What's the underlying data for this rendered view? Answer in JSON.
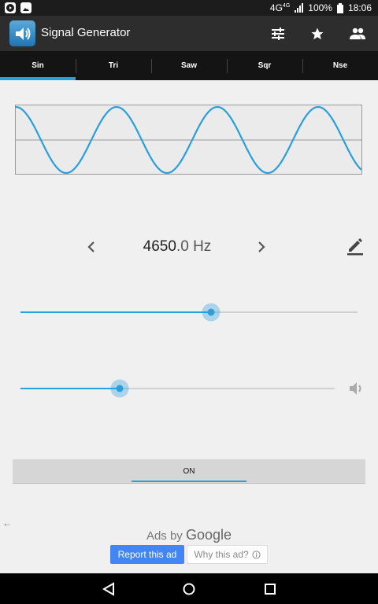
{
  "status_bar": {
    "network": "4G",
    "network_sup": "4G",
    "battery": "100%",
    "time": "18:06"
  },
  "app_bar": {
    "title": "Signal Generator",
    "icons": [
      "app-speaker-icon",
      "tune-icon",
      "star-icon",
      "people-icon"
    ]
  },
  "tabs": [
    {
      "label": "Sin",
      "active": true
    },
    {
      "label": "Tri",
      "active": false
    },
    {
      "label": "Saw",
      "active": false
    },
    {
      "label": "Sqr",
      "active": false
    },
    {
      "label": "Nse",
      "active": false
    }
  ],
  "frequency": {
    "integer": "4650",
    "fraction": ".0 Hz"
  },
  "sliders": {
    "frequency_level": 0.566,
    "volume_level": 0.315
  },
  "on_button": {
    "label": "ON"
  },
  "ads": {
    "ads_by": "Ads by",
    "google": "Google",
    "report": "Report this ad",
    "why": "Why this ad?"
  },
  "colors": {
    "accent": "#2a9fdd",
    "appbar": "#2d2d2d",
    "tabs": "#141414"
  }
}
